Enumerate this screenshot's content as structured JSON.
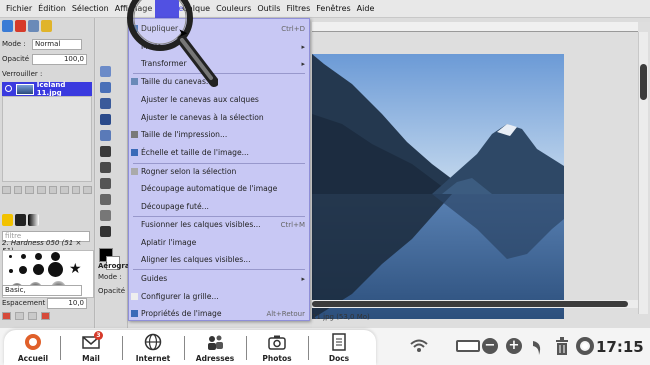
{
  "menubar": {
    "items": [
      "Fichier",
      "Édition",
      "Sélection",
      "Affichage",
      "Image",
      "Calque",
      "Couleurs",
      "Outils",
      "Filtres",
      "Fenêtres",
      "Aide"
    ]
  },
  "layers_panel": {
    "mode_label": "Mode :",
    "mode_value": "Normal",
    "opacity_label": "Opacité",
    "opacity_value": "100,0",
    "lock_label": "Verrouiller :",
    "layer_name": "Iceland 11.jpg",
    "filter_placeholder": "filtre",
    "brush_name": "2. Hardness 050 (51 × 51)",
    "brush_preset": "Basic,",
    "spacing_label": "Espacement",
    "spacing_value": "10,0"
  },
  "tool_options": {
    "title": "Aérograp",
    "mode_label": "Mode :",
    "opacity_label": "Opacité"
  },
  "calque_menu": {
    "items": [
      {
        "label": "Dupliquer",
        "accel": "Ctrl+D"
      },
      {
        "label": "Mode",
        "submenu": true
      },
      {
        "label": "Transformer",
        "submenu": true
      },
      {
        "label": "Taille du canevas..."
      },
      {
        "label": "Ajuster le canevas aux calques"
      },
      {
        "label": "Ajuster le canevas à la sélection"
      },
      {
        "label": "Taille de l'impression..."
      },
      {
        "label": "Échelle et taille de l'image..."
      },
      {
        "label": "Rogner selon la sélection"
      },
      {
        "label": "Découpage automatique de l'image"
      },
      {
        "label": "Découpage futé..."
      },
      {
        "label": "Fusionner les calques visibles...",
        "accel": "Ctrl+M"
      },
      {
        "label": "Aplatir l'image"
      },
      {
        "label": "Aligner les calques visibles..."
      },
      {
        "label": "Guides",
        "submenu": true
      },
      {
        "label": "Configurer la grille..."
      },
      {
        "label": "Propriétés de l'image",
        "accel": "Alt+Retour"
      }
    ]
  },
  "canvas": {
    "status_text": "11.jpg (53,0 Mo)"
  },
  "taskbar": {
    "apps": [
      {
        "label": "Accueil",
        "icon": "home-icon"
      },
      {
        "label": "Mail",
        "icon": "mail-icon",
        "badge": "3"
      },
      {
        "label": "Internet",
        "icon": "globe-icon"
      },
      {
        "label": "Adresses",
        "icon": "contacts-icon"
      },
      {
        "label": "Photos",
        "icon": "camera-icon"
      },
      {
        "label": "Docs",
        "icon": "document-icon"
      }
    ],
    "clock": "17:15"
  },
  "colors": {
    "menu_bg": "#c8c8f4",
    "highlight": "#3a3adf",
    "accent_orange": "#e0602a"
  }
}
